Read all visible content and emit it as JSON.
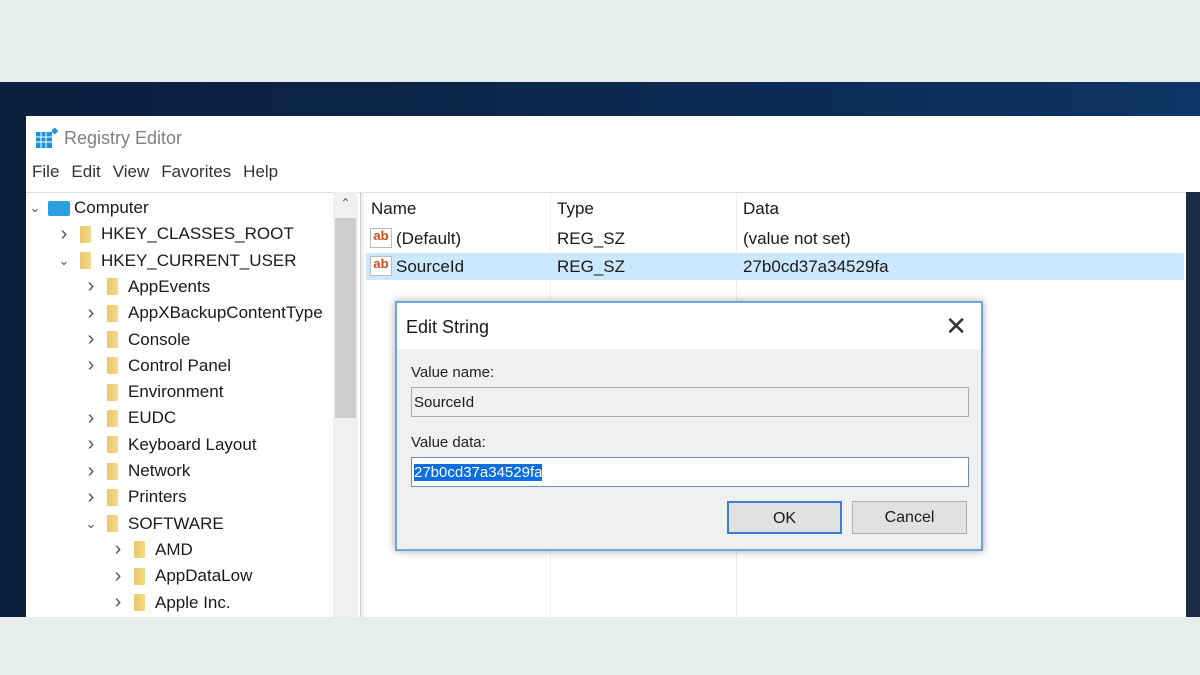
{
  "window": {
    "title": "Registry Editor"
  },
  "menu": [
    "File",
    "Edit",
    "View",
    "Favorites",
    "Help"
  ],
  "tree": {
    "items": [
      {
        "label": "Computer",
        "level": 0,
        "state": "expanded"
      },
      {
        "label": "HKEY_CLASSES_ROOT",
        "level": 1,
        "state": "collapsed"
      },
      {
        "label": "HKEY_CURRENT_USER",
        "level": 1,
        "state": "expanded"
      },
      {
        "label": "AppEvents",
        "level": 2,
        "state": "collapsed"
      },
      {
        "label": "AppXBackupContentType",
        "level": 2,
        "state": "collapsed"
      },
      {
        "label": "Console",
        "level": 2,
        "state": "collapsed"
      },
      {
        "label": "Control Panel",
        "level": 2,
        "state": "collapsed"
      },
      {
        "label": "Environment",
        "level": 2,
        "state": "leaf"
      },
      {
        "label": "EUDC",
        "level": 2,
        "state": "collapsed"
      },
      {
        "label": "Keyboard Layout",
        "level": 2,
        "state": "collapsed"
      },
      {
        "label": "Network",
        "level": 2,
        "state": "collapsed"
      },
      {
        "label": "Printers",
        "level": 2,
        "state": "collapsed"
      },
      {
        "label": "SOFTWARE",
        "level": 2,
        "state": "expanded"
      },
      {
        "label": "AMD",
        "level": 3,
        "state": "collapsed"
      },
      {
        "label": "AppDataLow",
        "level": 3,
        "state": "collapsed"
      },
      {
        "label": "Apple Inc.",
        "level": 3,
        "state": "collapsed"
      }
    ]
  },
  "list": {
    "columns": [
      "Name",
      "Type",
      "Data"
    ],
    "rows": [
      {
        "name": "(Default)",
        "type": "REG_SZ",
        "data": "(value not set)",
        "selected": false
      },
      {
        "name": "SourceId",
        "type": "REG_SZ",
        "data": "27b0cd37a34529fa",
        "selected": true
      }
    ]
  },
  "dialog": {
    "title": "Edit String",
    "value_name_label": "Value name:",
    "value_name": "SourceId",
    "value_data_label": "Value data:",
    "value_data": "27b0cd37a34529fa",
    "ok_label": "OK",
    "cancel_label": "Cancel"
  },
  "colors": {
    "selection": "#cce8ff",
    "accent": "#0a6ee0"
  }
}
